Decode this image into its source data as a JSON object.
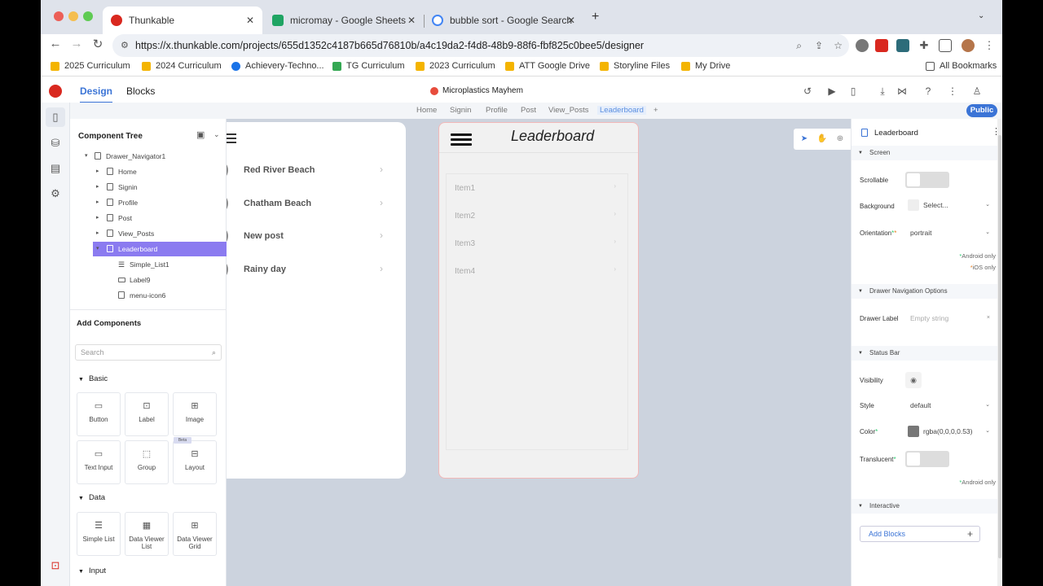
{
  "browser": {
    "tabs": [
      {
        "title": "Thunkable",
        "active": true
      },
      {
        "title": "micromay - Google Sheets",
        "active": false
      },
      {
        "title": "bubble sort - Google Search",
        "active": false
      }
    ],
    "url": "https://x.thunkable.com/projects/655d1352c4187b665d76810b/a4c19da2-f4d8-48b9-88f6-fbf825c0bee5/designer",
    "bookmarks": [
      "2025 Curriculum",
      "2024 Curriculum",
      "Achievery-Techno...",
      "TG Curriculum",
      "2023 Curriculum",
      "ATT Google Drive",
      "Storyline Files",
      "My Drive"
    ],
    "all_bookmarks": "All Bookmarks"
  },
  "app": {
    "tab_design": "Design",
    "tab_blocks": "Blocks",
    "project_name": "Microplastics Mayhem",
    "screens": [
      "Home",
      "Signin",
      "Profile",
      "Post",
      "View_Posts",
      "Leaderboard"
    ],
    "active_screen": "Leaderboard",
    "add_screen": "+",
    "public_label": "Public"
  },
  "left_panel": {
    "title": "Component Tree",
    "tree": [
      {
        "label": "Drawer_Navigator1"
      },
      {
        "label": "Home"
      },
      {
        "label": "Signin"
      },
      {
        "label": "Profile"
      },
      {
        "label": "Post"
      },
      {
        "label": "View_Posts"
      },
      {
        "label": "Leaderboard"
      },
      {
        "label": "Simple_List1"
      },
      {
        "label": "Label9"
      },
      {
        "label": "menu-icon6"
      }
    ],
    "add_components": "Add Components",
    "search_placeholder": "Search",
    "sections": {
      "basic": "Basic",
      "data": "Data",
      "input": "Input"
    },
    "basic": [
      "Button",
      "Label",
      "Image",
      "Text Input",
      "Group",
      "Layout"
    ],
    "beta": "Beta",
    "data": [
      "Simple List",
      "Data Viewer List",
      "Data Viewer Grid"
    ]
  },
  "canvas": {
    "old_items": [
      "Red River Beach",
      "Chatham Beach",
      "New post",
      "Rainy day"
    ],
    "phone_title": "Leaderboard",
    "list_items": [
      "Item1",
      "Item2",
      "Item3",
      "Item4"
    ]
  },
  "right_panel": {
    "title": "Leaderboard",
    "screen_section": "Screen",
    "scrollable": "Scrollable",
    "background": "Background",
    "background_value": "Select...",
    "orientation": "Orientation",
    "orientation_value": "portrait",
    "android_only": "Android only",
    "ios_only": "iOS only",
    "drawer_section": "Drawer Navigation Options",
    "drawer_label": "Drawer Label",
    "drawer_placeholder": "Empty string",
    "status_section": "Status Bar",
    "visibility": "Visibility",
    "style": "Style",
    "style_value": "default",
    "color": "Color",
    "color_value": "rgba(0,0,0,0.53)",
    "translucent": "Translucent",
    "android_only2": "Android only",
    "interactive_section": "Interactive",
    "add_blocks": "Add Blocks"
  }
}
